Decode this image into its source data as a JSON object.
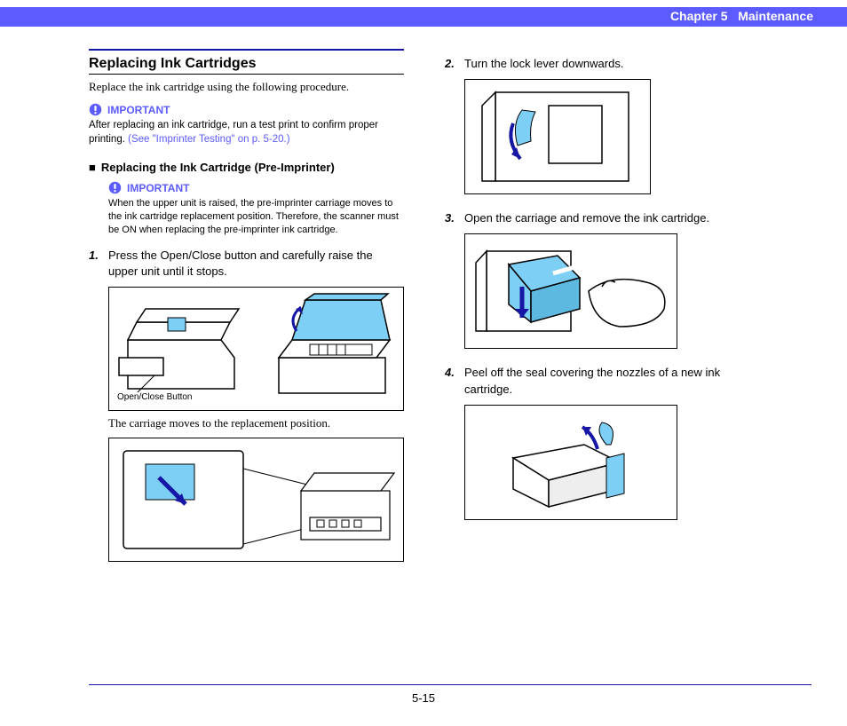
{
  "header": {
    "chapter": "Chapter 5",
    "title": "Maintenance"
  },
  "section": {
    "title": "Replacing Ink Cartridges",
    "intro": "Replace the ink cartridge using the following procedure."
  },
  "important1": {
    "label": "IMPORTANT",
    "body": "After replacing an ink cartridge, run a test print to confirm proper printing. ",
    "link": "(See \"Imprinter Testing\" on p. 5-20.)"
  },
  "subsection": {
    "bullet": "■",
    "title": "Replacing the Ink Cartridge (Pre-Imprinter)"
  },
  "important2": {
    "label": "IMPORTANT",
    "body": "When the upper unit is raised, the pre-imprinter carriage moves to the ink cartridge replacement position. Therefore, the scanner must be ON when replacing the pre-imprinter ink cartridge."
  },
  "steps": {
    "s1": {
      "num": "1.",
      "body": "Press the Open/Close button and carefully raise the upper unit until it stops."
    },
    "s1_caption": "The carriage moves to the replacement position.",
    "s1_fig_label": "Open/Close Button",
    "s2": {
      "num": "2.",
      "body": "Turn the lock lever downwards."
    },
    "s3": {
      "num": "3.",
      "body": "Open the carriage and remove the ink cartridge."
    },
    "s4": {
      "num": "4.",
      "body": "Peel off the seal covering the nozzles of a new ink cartridge."
    }
  },
  "page_number": "5-15",
  "colors": {
    "accent": "#5b5bff",
    "figure_fill": "#7ecff5"
  }
}
